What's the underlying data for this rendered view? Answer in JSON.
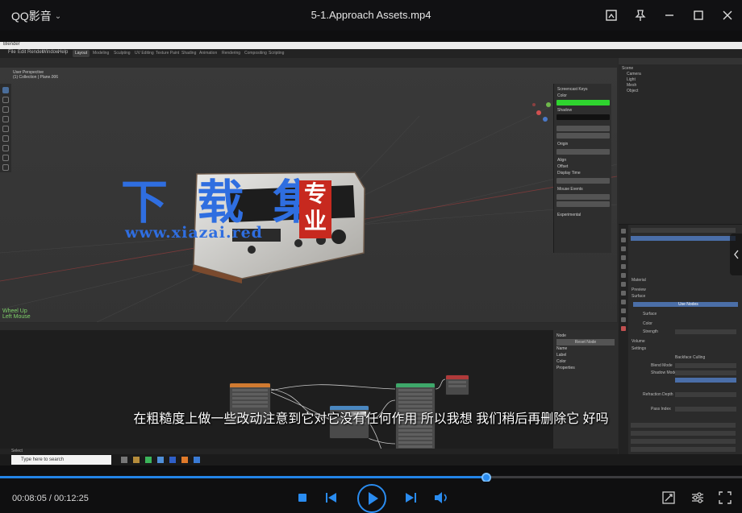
{
  "titlebar": {
    "app_name": "QQ影音",
    "file_title": "5-1.Approach Assets.mp4"
  },
  "blender": {
    "window_title": "Blender",
    "menus": [
      "File",
      "Edit",
      "Render",
      "Window",
      "Help"
    ],
    "tabs": [
      "Layout",
      "Modeling",
      "Sculpting",
      "UV Editing",
      "Texture Paint",
      "Shading",
      "Animation",
      "Rendering",
      "Compositing",
      "Scripting"
    ],
    "active_tab": "Layout",
    "viewport_info": [
      "User Perspective",
      "(1) Collection | Plane.006"
    ],
    "npanel_labels": [
      "Screencast Keys",
      "Color",
      "Shadow",
      "Origin",
      "Align",
      "Offset",
      "Display Time",
      "Mouse Events",
      "Experimental"
    ],
    "outliner_items": [
      "Scene",
      "Camera",
      "Light",
      "Mesh",
      "Object"
    ],
    "props_labels": [
      "Material",
      "Preview",
      "Surface",
      "Use Nodes",
      "Surface",
      "Color",
      "Strength",
      "Volume",
      "Settings",
      "Backface Culling",
      "Blend Mode",
      "Shadow Mode",
      "Refraction Depth",
      "Pass Index"
    ],
    "node_side_labels": [
      "Node",
      "Reset Node",
      "Name",
      "Label",
      "Color",
      "Properties"
    ],
    "overlay_keys": [
      "Wheel Up",
      "Left Mouse"
    ],
    "status_left": "Select",
    "taskbar_search": "Type here to search"
  },
  "watermark": {
    "chinese": "下 载 集",
    "url": "www.xiazai.red",
    "tag": "专业"
  },
  "subtitle": "在粗糙度上做一些改动注意到它对它没有任何作用 所以我想 我们稍后再删除它 好吗",
  "player": {
    "time_current": "00:08:05",
    "time_total": "00:12:25",
    "time_text": "00:08:05 / 00:12:25",
    "progress": 0.655
  },
  "colors": {
    "accent": "#2384e6",
    "watermark": "#2f6ee0",
    "tag": "#c7291f"
  }
}
